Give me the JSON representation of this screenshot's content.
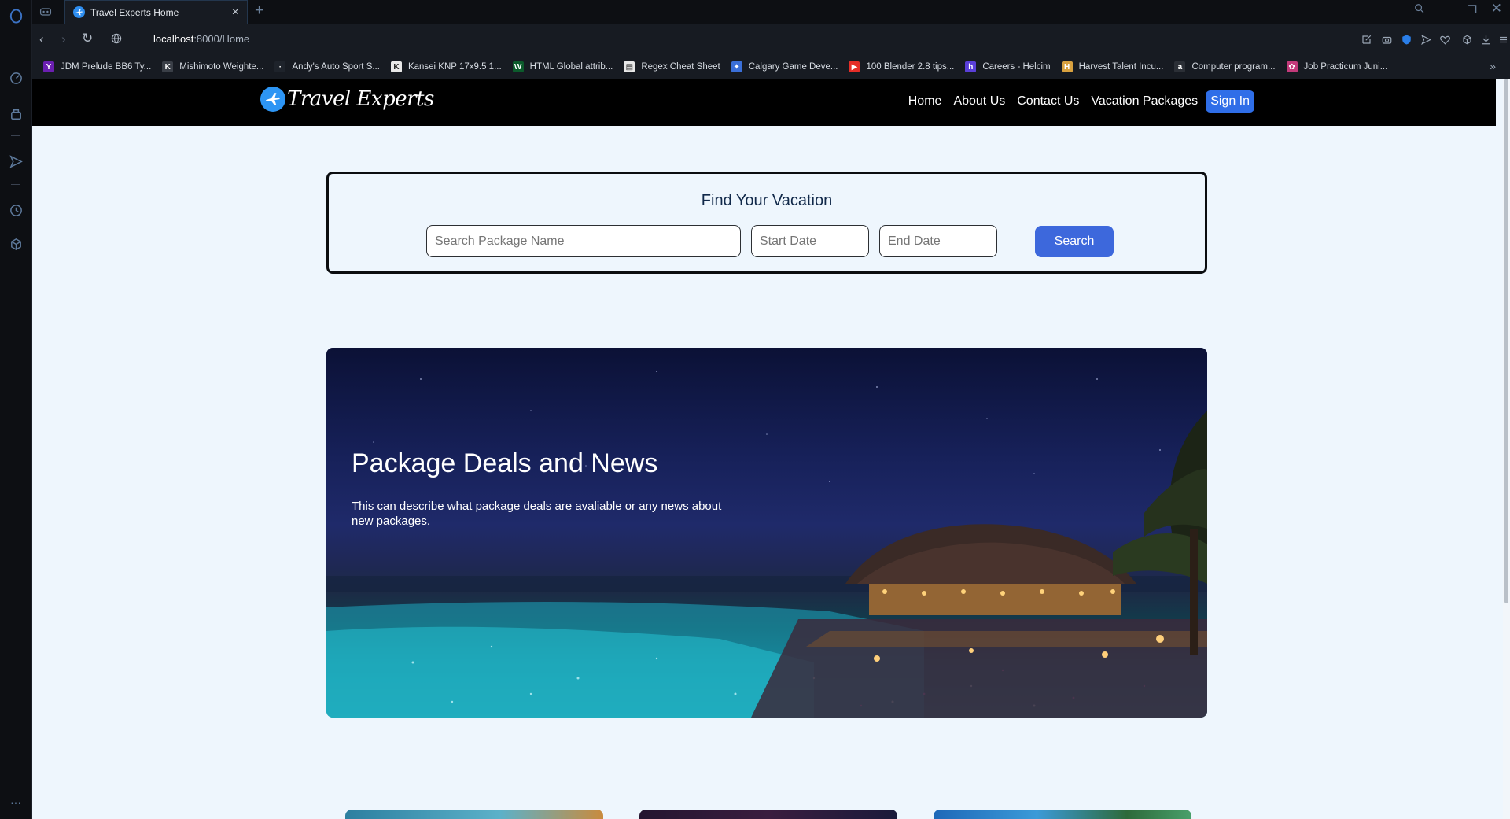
{
  "browser": {
    "tab": {
      "title": "Travel Experts Home"
    },
    "address": {
      "host": "localhost",
      "path": ":8000/Home"
    },
    "bookmarks": [
      {
        "label": "JDM Prelude BB6 Ty...",
        "icon": "Y",
        "color": "#6b1fb1"
      },
      {
        "label": "Mishimoto Weighte...",
        "icon": "K",
        "color": "#3a3f47"
      },
      {
        "label": "Andy's Auto Sport S...",
        "icon": "·",
        "color": "#1e232b"
      },
      {
        "label": "Kansei KNP 17x9.5 1...",
        "icon": "K",
        "color": "#e8e8e8"
      },
      {
        "label": "HTML Global attrib...",
        "icon": "W",
        "color": "#0c5b2c"
      },
      {
        "label": "Regex Cheat Sheet",
        "icon": "▤",
        "color": "#e8e8e8"
      },
      {
        "label": "Calgary Game Deve...",
        "icon": "✦",
        "color": "#3a6fd8"
      },
      {
        "label": "100 Blender 2.8 tips...",
        "icon": "▶",
        "color": "#e52d27"
      },
      {
        "label": "Careers - Helcim",
        "icon": "h",
        "color": "#5a3fd8"
      },
      {
        "label": "Harvest Talent Incu...",
        "icon": "H",
        "color": "#d8a13f"
      },
      {
        "label": "Computer program...",
        "icon": "a",
        "color": "#2b2f36"
      },
      {
        "label": "Job Practicum Juni...",
        "icon": "✿",
        "color": "#c23a7a"
      }
    ]
  },
  "site": {
    "logo_text": "Travel Experts",
    "nav": [
      "Home",
      "About Us",
      "Contact Us",
      "Vacation Packages"
    ],
    "signin_label": "Sign In",
    "search": {
      "title": "Find Your Vacation",
      "package_placeholder": "Search Package Name",
      "start_placeholder": "Start Date",
      "end_placeholder": "End Date",
      "button_label": "Search"
    },
    "hero": {
      "title": "Package Deals and News",
      "text": "This can describe what package deals are avaliable or any news about new packages."
    }
  },
  "colors": {
    "accent": "#3d68dc",
    "signin": "#2f6ee8",
    "page_bg": "#eef6fd",
    "header_bg": "#000000"
  }
}
